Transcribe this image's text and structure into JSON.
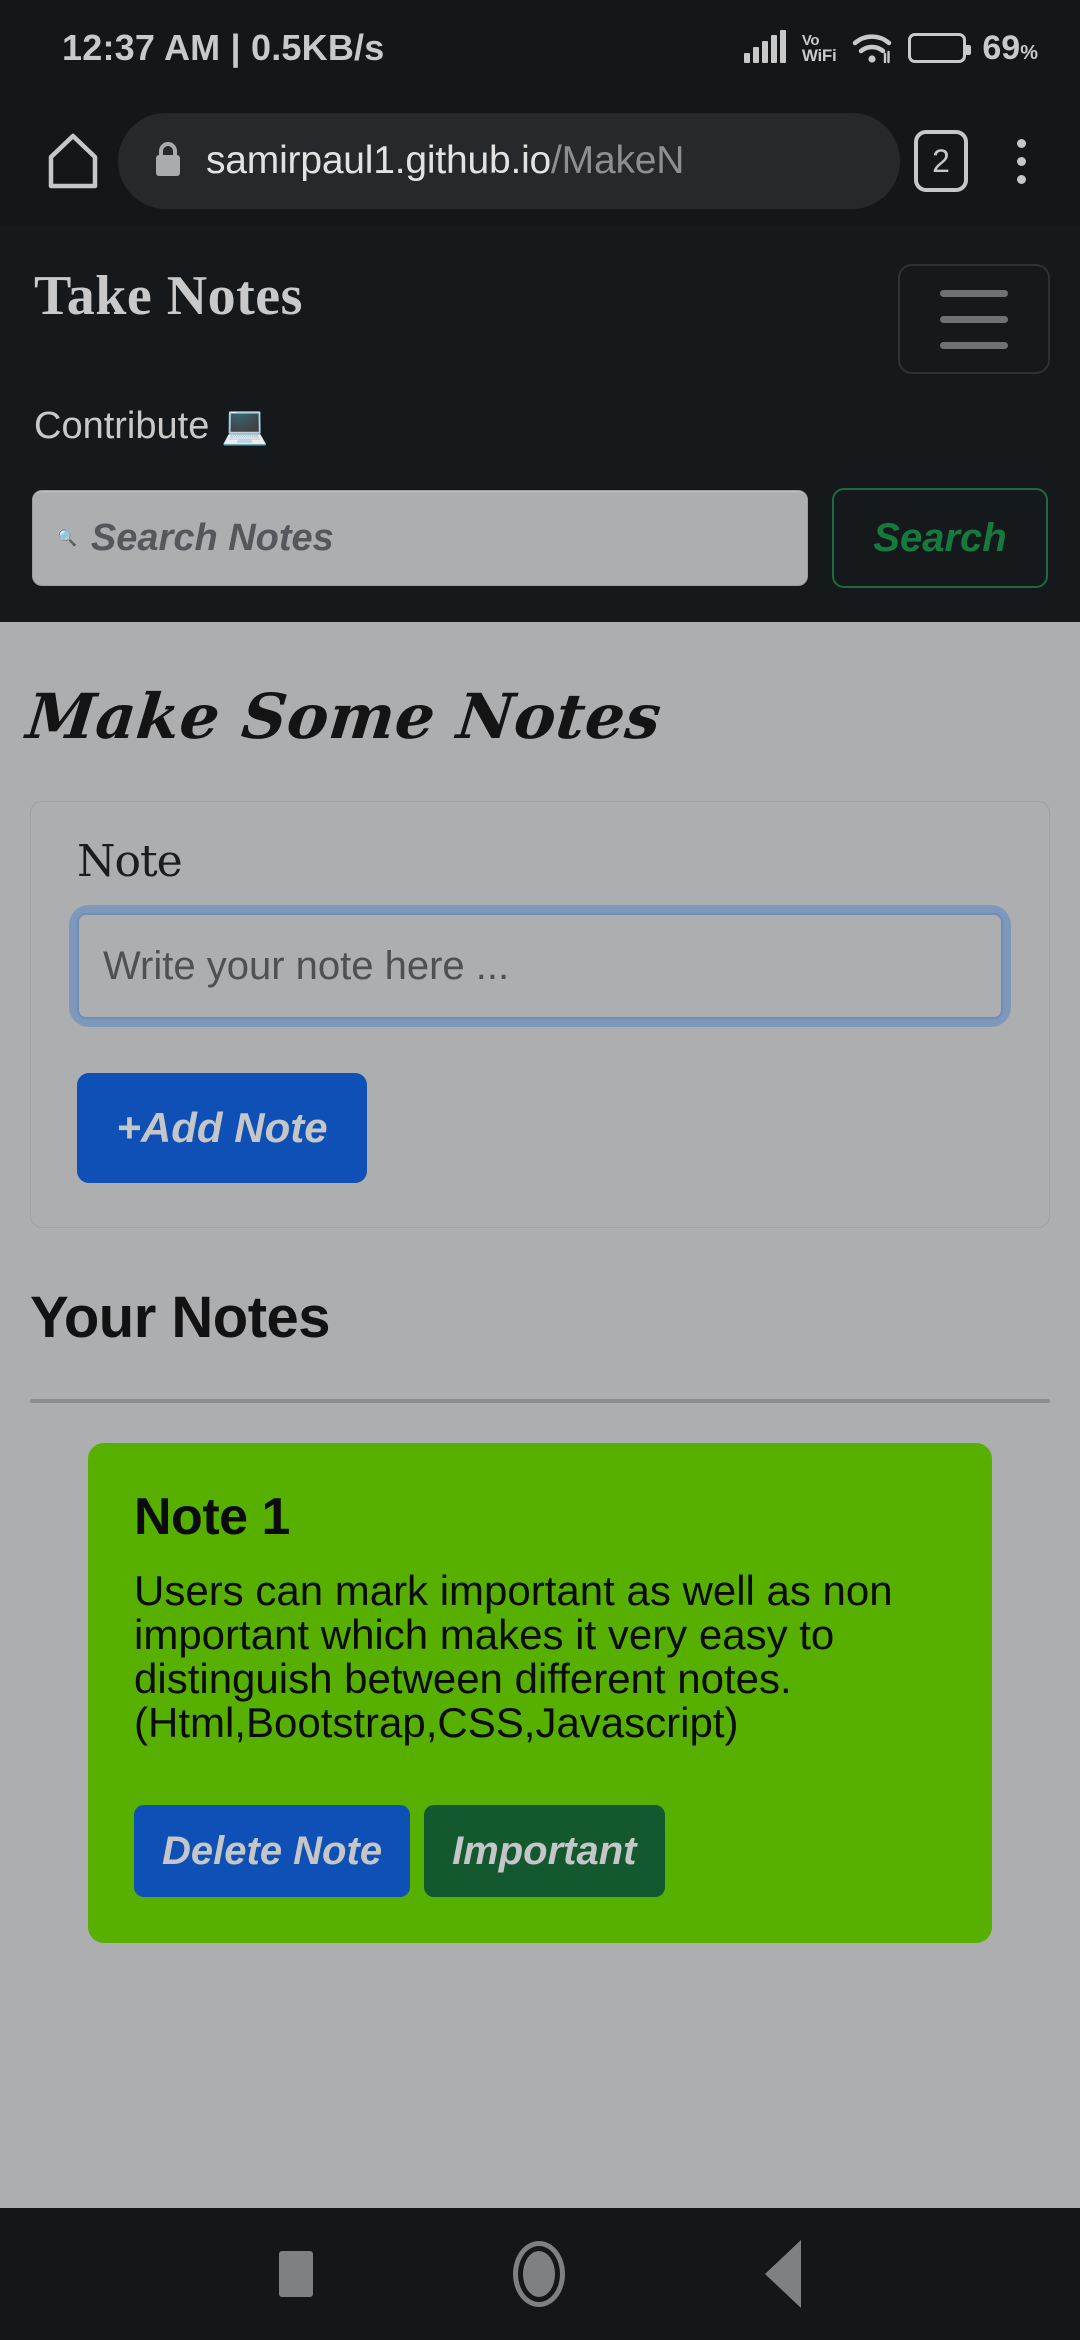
{
  "status_bar": {
    "clock": "12:37 AM | 0.5KB/s",
    "signal_icon": "signal-bars-icon",
    "vo_label": "Vo",
    "wifi_label": "WiFi",
    "wifi_icon": "wifi-icon",
    "battery_icon": "battery-icon",
    "battery_percent": 69,
    "battery_text": "69",
    "battery_unit": "%"
  },
  "browser": {
    "home_icon": "home-icon",
    "lock_icon": "lock-icon",
    "url_visible": "samirpaul1.github.io",
    "url_dim": "/MakeN",
    "tab_count": "2",
    "menu_icon": "kebab-menu-icon"
  },
  "site_header": {
    "brand": "Take Notes",
    "menu_button_label": "hamburger-menu",
    "contribute_label": "Contribute",
    "contribute_icon": "💻",
    "search": {
      "icon": "🔍",
      "placeholder": "Search Notes",
      "value": "",
      "button_label": "Search",
      "button_color": "#167a3e"
    }
  },
  "page": {
    "title": "Make Some Notes",
    "form": {
      "label": "Note",
      "placeholder": "Write your note here ...",
      "value": "",
      "add_button_label": "+Add Note",
      "add_button_color": "#0e50b5"
    },
    "notes_heading": "Your Notes",
    "notes": [
      {
        "title": "Note 1",
        "body": "Users can mark important as well as non important which makes it very easy to distinguish between different notes.\n(Html,Bootstrap,CSS,Javascript)",
        "card_color": "#57b000",
        "delete_label": "Delete Note",
        "important_label": "Important"
      }
    ]
  },
  "system_nav": {
    "recents_icon": "square-recents-icon",
    "home_icon": "circle-home-icon",
    "back_icon": "triangle-back-icon"
  }
}
